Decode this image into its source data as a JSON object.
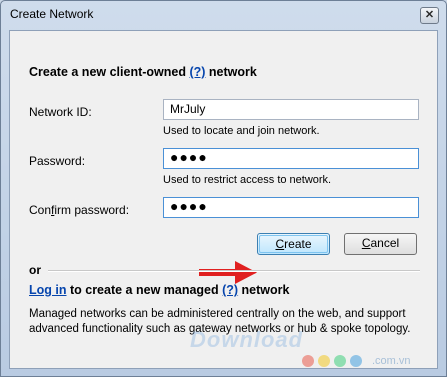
{
  "window": {
    "title": "Create Network",
    "close_glyph": "✕"
  },
  "form": {
    "heading_prefix": "Create a new client-owned ",
    "heading_link": "(?)",
    "heading_suffix": " network",
    "network_id_label": "Network ID:",
    "network_id_value": "MrJuly",
    "network_id_hint": "Used to locate and join network.",
    "password_label": "Password:",
    "password_value": "●●●●",
    "password_hint": "Used to restrict access to network.",
    "confirm_label_prefix": "Con",
    "confirm_label_access": "f",
    "confirm_label_suffix": "irm password:",
    "confirm_value": "●●●●"
  },
  "buttons": {
    "create_access": "C",
    "create_rest": "reate",
    "cancel_access": "C",
    "cancel_rest": "ancel"
  },
  "or_label": "or",
  "managed": {
    "login_link": "Log in",
    "text_middle": " to create a new managed ",
    "help_link": "(?)",
    "text_suffix": " network",
    "description": "Managed networks can be administered centrally on the web, and support advanced functionality such as gateway networks or hub & spoke topology."
  },
  "watermark": {
    "brand": "Download",
    "suffix": ".com.vn"
  },
  "colors": {
    "link": "#0645ad",
    "arrow": "#e02020",
    "focus_border": "#4a90d6"
  }
}
